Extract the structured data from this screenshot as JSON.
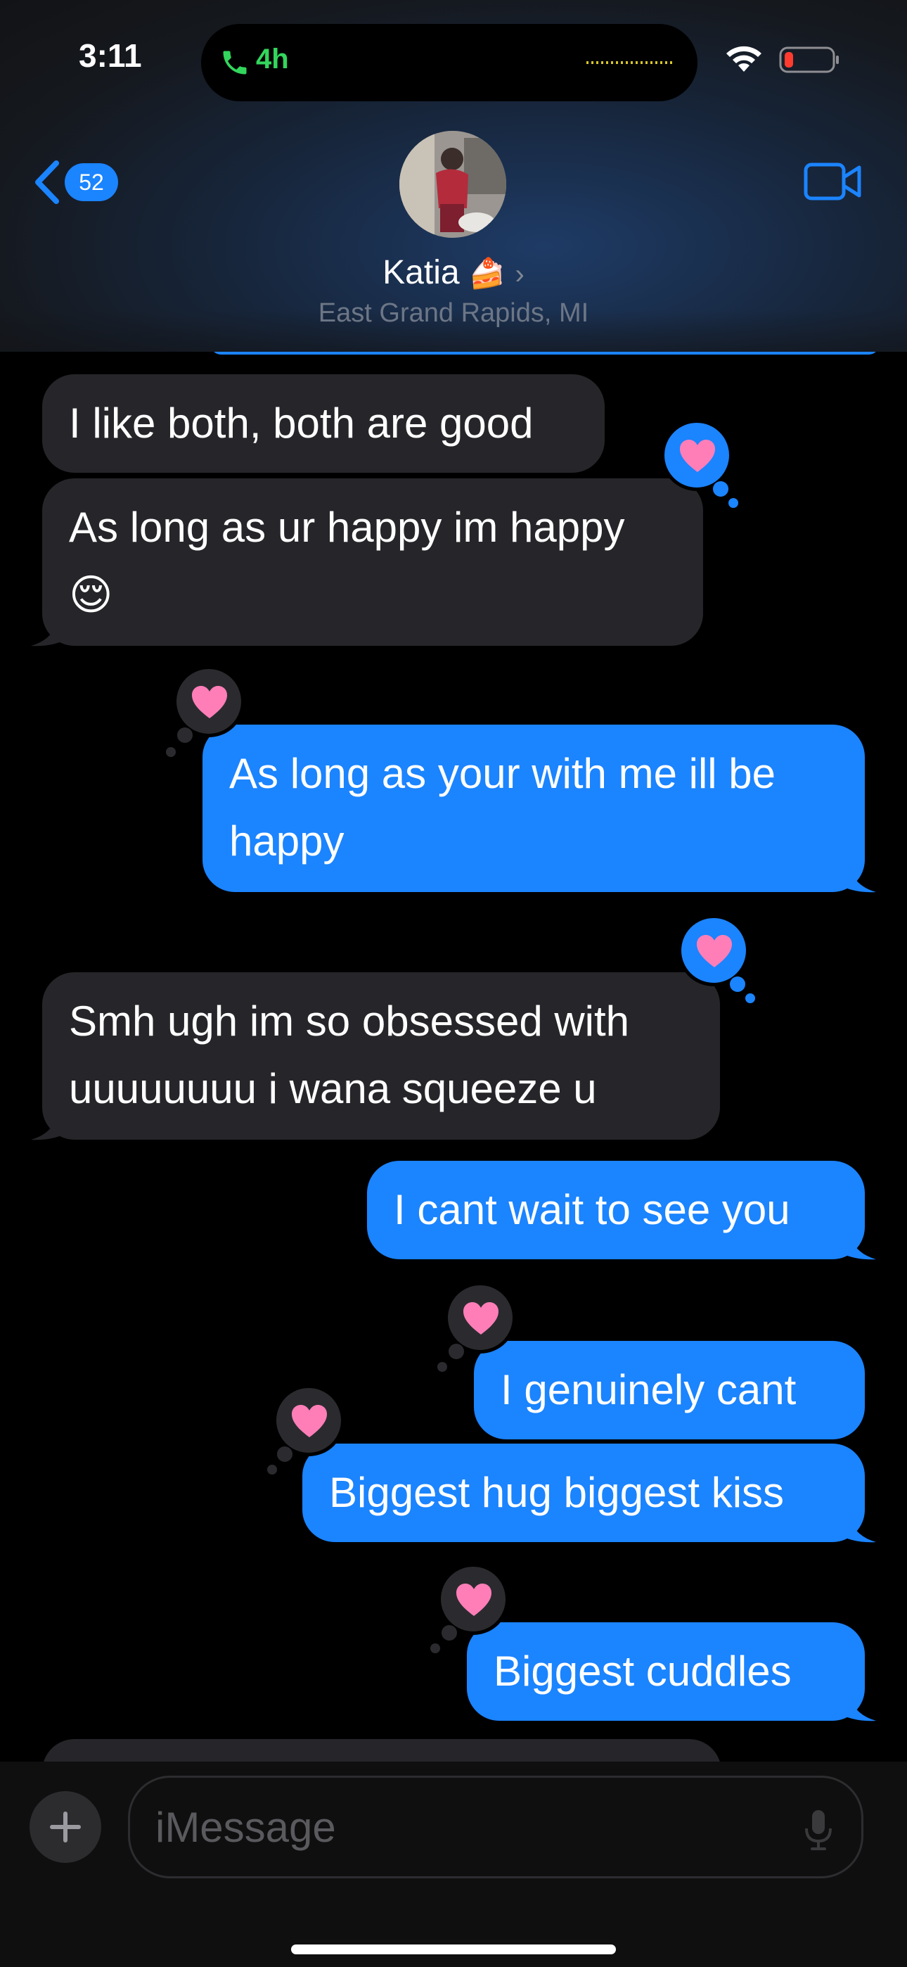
{
  "status_bar": {
    "time": "3:11",
    "call_duration": "4h"
  },
  "header": {
    "back_badge": "52",
    "contact_name": "Katia",
    "contact_emoji": "🍰",
    "chevron": "›",
    "location": "East Grand Rapids, MI"
  },
  "messages": [
    {
      "from": "them",
      "text": "I like both, both are good"
    },
    {
      "from": "them",
      "line1": "As long as ur happy im happy",
      "line2": "😌",
      "reaction": "heart"
    },
    {
      "from": "me",
      "line1": "As long as your with me ill be",
      "line2": "happy",
      "reaction": "heart"
    },
    {
      "from": "them",
      "line1": "Smh ugh im so obsessed with",
      "line2": "uuuuuuuu i wana squeeze u",
      "reaction": "heart"
    },
    {
      "from": "me",
      "text": "I cant wait to see you"
    },
    {
      "from": "me",
      "text": "I genuinely cant",
      "reaction": "heart"
    },
    {
      "from": "me",
      "text": "Biggest hug biggest kiss",
      "reaction": "heart"
    },
    {
      "from": "me",
      "text": "Biggest cuddles",
      "reaction": "heart"
    }
  ],
  "composer": {
    "placeholder": "iMessage"
  },
  "colors": {
    "sent_bubble": "#1b84ff",
    "received_bubble": "#26262a",
    "heart": "#ff7eb8"
  }
}
